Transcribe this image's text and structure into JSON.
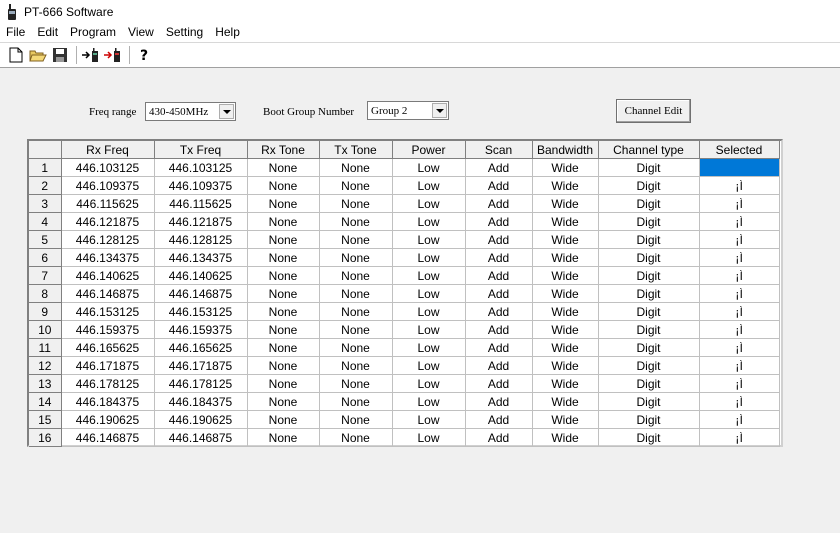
{
  "window": {
    "title": "PT-666 Software"
  },
  "menu": [
    "File",
    "Edit",
    "Program",
    "View",
    "Setting",
    "Help"
  ],
  "toolbar": {
    "icons": [
      "new-file-icon",
      "open-folder-icon",
      "save-icon",
      "read-radio-icon",
      "write-radio-icon",
      "help-icon"
    ]
  },
  "controls": {
    "freq_range_label": "Freq range",
    "freq_range_value": "430-450MHz",
    "boot_group_label": "Boot Group Number",
    "boot_group_value": "Group 2",
    "channel_edit_label": "Channel Edit"
  },
  "table": {
    "columns": [
      "Rx Freq",
      "Tx Freq",
      "Rx Tone",
      "Tx Tone",
      "Power",
      "Scan",
      "Bandwidth",
      "Channel type",
      "Selected"
    ],
    "rows": [
      {
        "n": "1",
        "rx": "446.103125",
        "tx": "446.103125",
        "rxt": "None",
        "txt": "None",
        "pw": "Low",
        "sc": "Add",
        "bw": "Wide",
        "ct": "Digit",
        "sel": ""
      },
      {
        "n": "2",
        "rx": "446.109375",
        "tx": "446.109375",
        "rxt": "None",
        "txt": "None",
        "pw": "Low",
        "sc": "Add",
        "bw": "Wide",
        "ct": "Digit",
        "sel": "¡Ì"
      },
      {
        "n": "3",
        "rx": "446.115625",
        "tx": "446.115625",
        "rxt": "None",
        "txt": "None",
        "pw": "Low",
        "sc": "Add",
        "bw": "Wide",
        "ct": "Digit",
        "sel": "¡Ì"
      },
      {
        "n": "4",
        "rx": "446.121875",
        "tx": "446.121875",
        "rxt": "None",
        "txt": "None",
        "pw": "Low",
        "sc": "Add",
        "bw": "Wide",
        "ct": "Digit",
        "sel": "¡Ì"
      },
      {
        "n": "5",
        "rx": "446.128125",
        "tx": "446.128125",
        "rxt": "None",
        "txt": "None",
        "pw": "Low",
        "sc": "Add",
        "bw": "Wide",
        "ct": "Digit",
        "sel": "¡Ì"
      },
      {
        "n": "6",
        "rx": "446.134375",
        "tx": "446.134375",
        "rxt": "None",
        "txt": "None",
        "pw": "Low",
        "sc": "Add",
        "bw": "Wide",
        "ct": "Digit",
        "sel": "¡Ì"
      },
      {
        "n": "7",
        "rx": "446.140625",
        "tx": "446.140625",
        "rxt": "None",
        "txt": "None",
        "pw": "Low",
        "sc": "Add",
        "bw": "Wide",
        "ct": "Digit",
        "sel": "¡Ì"
      },
      {
        "n": "8",
        "rx": "446.146875",
        "tx": "446.146875",
        "rxt": "None",
        "txt": "None",
        "pw": "Low",
        "sc": "Add",
        "bw": "Wide",
        "ct": "Digit",
        "sel": "¡Ì"
      },
      {
        "n": "9",
        "rx": "446.153125",
        "tx": "446.153125",
        "rxt": "None",
        "txt": "None",
        "pw": "Low",
        "sc": "Add",
        "bw": "Wide",
        "ct": "Digit",
        "sel": "¡Ì"
      },
      {
        "n": "10",
        "rx": "446.159375",
        "tx": "446.159375",
        "rxt": "None",
        "txt": "None",
        "pw": "Low",
        "sc": "Add",
        "bw": "Wide",
        "ct": "Digit",
        "sel": "¡Ì"
      },
      {
        "n": "11",
        "rx": "446.165625",
        "tx": "446.165625",
        "rxt": "None",
        "txt": "None",
        "pw": "Low",
        "sc": "Add",
        "bw": "Wide",
        "ct": "Digit",
        "sel": "¡Ì"
      },
      {
        "n": "12",
        "rx": "446.171875",
        "tx": "446.171875",
        "rxt": "None",
        "txt": "None",
        "pw": "Low",
        "sc": "Add",
        "bw": "Wide",
        "ct": "Digit",
        "sel": "¡Ì"
      },
      {
        "n": "13",
        "rx": "446.178125",
        "tx": "446.178125",
        "rxt": "None",
        "txt": "None",
        "pw": "Low",
        "sc": "Add",
        "bw": "Wide",
        "ct": "Digit",
        "sel": "¡Ì"
      },
      {
        "n": "14",
        "rx": "446.184375",
        "tx": "446.184375",
        "rxt": "None",
        "txt": "None",
        "pw": "Low",
        "sc": "Add",
        "bw": "Wide",
        "ct": "Digit",
        "sel": "¡Ì"
      },
      {
        "n": "15",
        "rx": "446.190625",
        "tx": "446.190625",
        "rxt": "None",
        "txt": "None",
        "pw": "Low",
        "sc": "Add",
        "bw": "Wide",
        "ct": "Digit",
        "sel": "¡Ì"
      },
      {
        "n": "16",
        "rx": "446.146875",
        "tx": "446.146875",
        "rxt": "None",
        "txt": "None",
        "pw": "Low",
        "sc": "Add",
        "bw": "Wide",
        "ct": "Digit",
        "sel": "¡Ì"
      }
    ]
  },
  "colors": {
    "selection": "#0078d7",
    "panel": "#f0f0f0"
  }
}
